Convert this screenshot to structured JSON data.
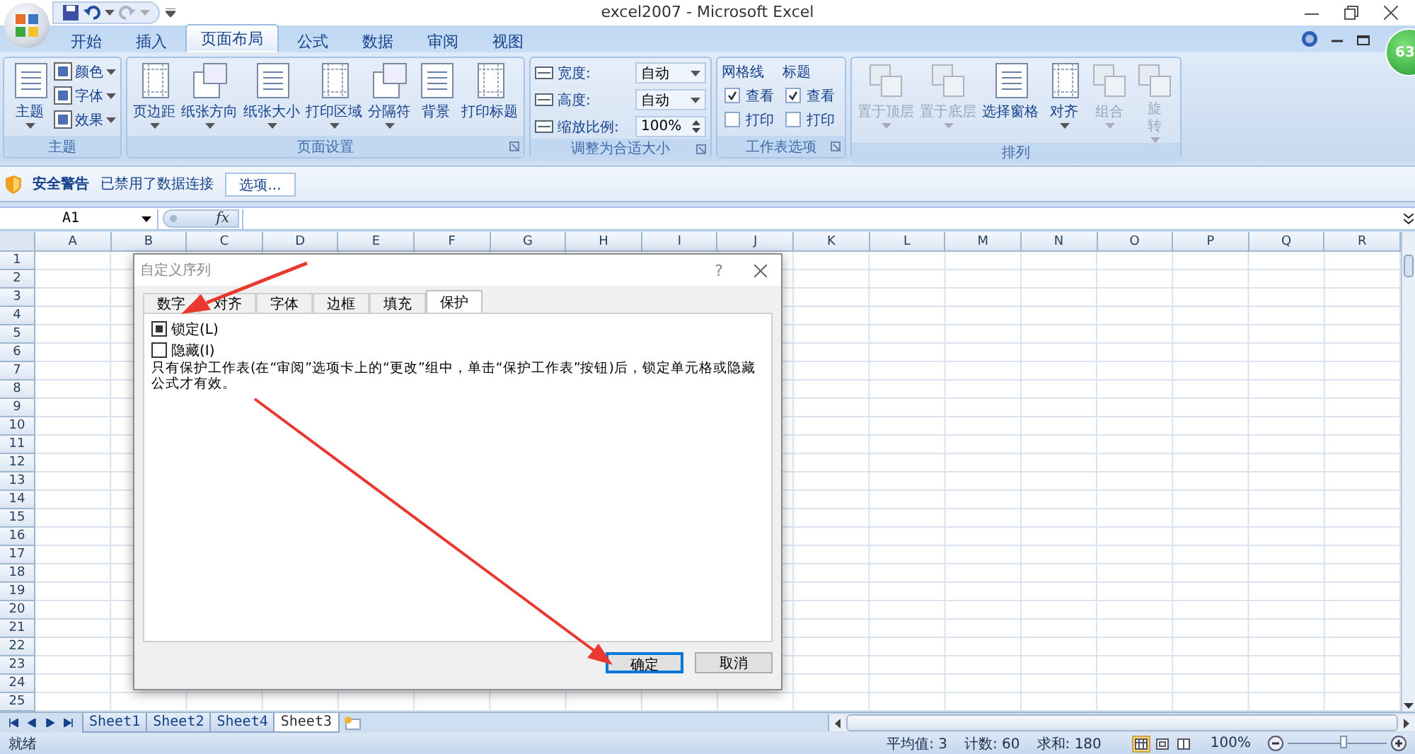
{
  "window": {
    "title": "excel2007 - Microsoft Excel"
  },
  "ribbon_tabs": [
    {
      "label": "开始",
      "selected": false
    },
    {
      "label": "插入",
      "selected": false
    },
    {
      "label": "页面布局",
      "selected": true
    },
    {
      "label": "公式",
      "selected": false
    },
    {
      "label": "数据",
      "selected": false
    },
    {
      "label": "审阅",
      "selected": false
    },
    {
      "label": "视图",
      "selected": false
    }
  ],
  "badge": "63",
  "ribbon_groups": [
    {
      "label": "主题",
      "launcher": false,
      "items": [
        {
          "kind": "large",
          "label": "主题",
          "dropdown": true,
          "disabled": false
        },
        {
          "kind": "small",
          "label": "颜色"
        },
        {
          "kind": "small",
          "label": "字体"
        },
        {
          "kind": "small",
          "label": "效果"
        }
      ]
    },
    {
      "label": "页面设置",
      "launcher": true,
      "items": [
        {
          "kind": "large",
          "label": "页边距",
          "dropdown": true,
          "disabled": false
        },
        {
          "kind": "large",
          "label": "纸张方向",
          "dropdown": true,
          "disabled": false
        },
        {
          "kind": "large",
          "label": "纸张大小",
          "dropdown": true,
          "disabled": false
        },
        {
          "kind": "large",
          "label": "打印区域",
          "dropdown": true,
          "disabled": false
        },
        {
          "kind": "large",
          "label": "分隔符",
          "dropdown": true,
          "disabled": false
        },
        {
          "kind": "large",
          "label": "背景",
          "dropdown": false,
          "disabled": false
        },
        {
          "kind": "large",
          "label": "打印标题",
          "dropdown": false,
          "disabled": false
        }
      ]
    },
    {
      "label": "调整为合适大小",
      "launcher": true,
      "items": [
        {
          "kind": "select",
          "label": "宽度:",
          "value": "自动"
        },
        {
          "kind": "select",
          "label": "高度:",
          "value": "自动"
        },
        {
          "kind": "spin",
          "label": "缩放比例:",
          "value": "100%"
        }
      ]
    },
    {
      "label": "工作表选项",
      "launcher": true,
      "items": [
        {
          "kind": "checks",
          "label": "网格线",
          "options": [
            {
              "label": "查看",
              "checked": true
            },
            {
              "label": "打印",
              "checked": false
            }
          ]
        },
        {
          "kind": "checks",
          "label": "标题",
          "options": [
            {
              "label": "查看",
              "checked": true
            },
            {
              "label": "打印",
              "checked": false
            }
          ]
        }
      ]
    },
    {
      "label": "排列",
      "launcher": false,
      "items": [
        {
          "kind": "large",
          "label": "置于顶层",
          "dropdown": true,
          "disabled": true
        },
        {
          "kind": "large",
          "label": "置于底层",
          "dropdown": true,
          "disabled": true
        },
        {
          "kind": "large",
          "label": "选择窗格",
          "dropdown": false,
          "disabled": false
        },
        {
          "kind": "large",
          "label": "对齐",
          "dropdown": true,
          "disabled": false
        },
        {
          "kind": "large",
          "label": "组合",
          "dropdown": true,
          "disabled": true
        },
        {
          "kind": "large",
          "label": "旋转",
          "dropdown": true,
          "disabled": true
        }
      ]
    }
  ],
  "security_bar": {
    "title": "安全警告",
    "message": "已禁用了数据连接",
    "button": "选项..."
  },
  "formula_bar": {
    "name_box": "A1",
    "function_label": "fx"
  },
  "sheet": {
    "columns": [
      "A",
      "B",
      "C",
      "D",
      "E",
      "F",
      "G",
      "H",
      "I",
      "J",
      "K",
      "L",
      "M",
      "N",
      "O",
      "P",
      "Q",
      "R"
    ],
    "rows": [
      "1",
      "2",
      "3",
      "4",
      "5",
      "6",
      "7",
      "8",
      "9",
      "10",
      "11",
      "12",
      "13",
      "14",
      "15",
      "16",
      "17",
      "18",
      "19",
      "20",
      "21",
      "22",
      "23",
      "24",
      "25"
    ]
  },
  "dialog": {
    "title": "自定义序列",
    "help": "?",
    "tabs": [
      {
        "label": "数字",
        "selected": false
      },
      {
        "label": "对齐",
        "selected": false
      },
      {
        "label": "字体",
        "selected": false
      },
      {
        "label": "边框",
        "selected": false
      },
      {
        "label": "填充",
        "selected": false
      },
      {
        "label": "保护",
        "selected": true
      }
    ],
    "options": [
      {
        "label": "锁定(L)",
        "checked": true
      },
      {
        "label": "隐藏(I)",
        "checked": false
      }
    ],
    "note": "只有保护工作表(在“审阅”选项卡上的“更改”组中，单击“保护工作表”按钮)后，锁定单元格或隐藏公式才有效。",
    "buttons": [
      {
        "label": "确定",
        "default": true
      },
      {
        "label": "取消",
        "default": false
      }
    ]
  },
  "sheet_tabs": [
    {
      "label": "Sheet1",
      "selected": false
    },
    {
      "label": "Sheet2",
      "selected": false
    },
    {
      "label": "Sheet4",
      "selected": false
    },
    {
      "label": "Sheet3",
      "selected": true
    }
  ],
  "status_bar": {
    "status": "就绪",
    "stats": [
      "平均值: 3",
      "计数: 60",
      "求和: 180"
    ],
    "views": [
      {
        "selected": true
      },
      {
        "selected": false
      },
      {
        "selected": false
      }
    ],
    "zoom": "100%",
    "zoom_level": {
      "level": 0.55
    }
  }
}
